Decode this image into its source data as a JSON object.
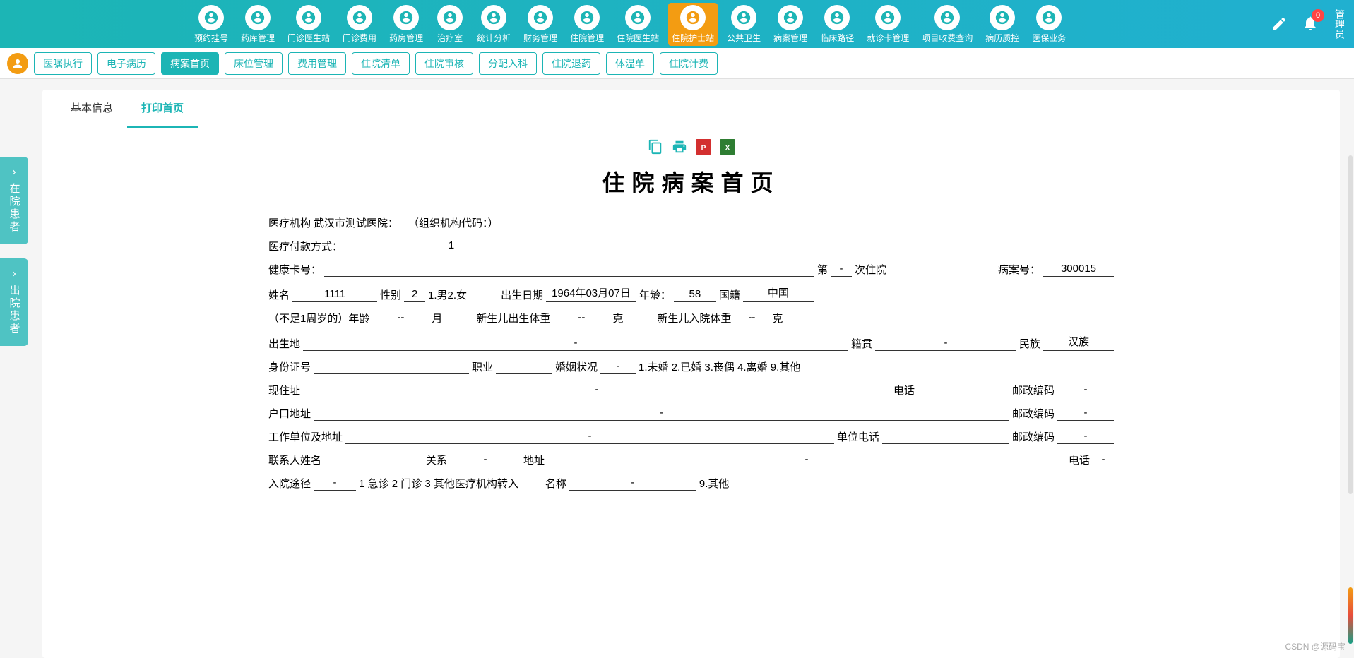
{
  "topNav": {
    "items": [
      {
        "label": "预约挂号",
        "icon": "calendar"
      },
      {
        "label": "药库管理",
        "icon": "home"
      },
      {
        "label": "门诊医生站",
        "icon": "doctor"
      },
      {
        "label": "门诊费用",
        "icon": "yen"
      },
      {
        "label": "药房管理",
        "icon": "pill"
      },
      {
        "label": "治疗室",
        "icon": "treat"
      },
      {
        "label": "统计分析",
        "icon": "chart"
      },
      {
        "label": "财务管理",
        "icon": "gear"
      },
      {
        "label": "住院管理",
        "icon": "bed"
      },
      {
        "label": "住院医生站",
        "icon": "docbed"
      },
      {
        "label": "住院护士站",
        "icon": "nurse",
        "active": true
      },
      {
        "label": "公共卫生",
        "icon": "target"
      },
      {
        "label": "病案管理",
        "icon": "file"
      },
      {
        "label": "临床路径",
        "icon": "path"
      },
      {
        "label": "就诊卡管理",
        "icon": "card"
      },
      {
        "label": "项目收费查询",
        "icon": "search"
      },
      {
        "label": "病历质控",
        "icon": "quality"
      },
      {
        "label": "医保业务",
        "icon": "insurance"
      }
    ],
    "badgeCount": "0",
    "adminLabel": "管理员"
  },
  "subNav": {
    "items": [
      {
        "label": "医嘱执行"
      },
      {
        "label": "电子病历"
      },
      {
        "label": "病案首页",
        "active": true
      },
      {
        "label": "床位管理"
      },
      {
        "label": "费用管理"
      },
      {
        "label": "住院清单"
      },
      {
        "label": "住院审核"
      },
      {
        "label": "分配入科"
      },
      {
        "label": "住院退药"
      },
      {
        "label": "体温单"
      },
      {
        "label": "住院计费"
      }
    ]
  },
  "sideTabs": [
    {
      "label": "在院患者"
    },
    {
      "label": "出院患者"
    }
  ],
  "contentTabs": [
    {
      "label": "基本信息"
    },
    {
      "label": "打印首页",
      "active": true
    }
  ],
  "doc": {
    "title": "住院病案首页",
    "orgLabel": "医疗机构",
    "orgName": "武汉市测试医院：",
    "orgCodeLabel": "（组织机构代码：）",
    "paymentLabel": "医疗付款方式：",
    "paymentValue": "1",
    "healthCardLabel": "健康卡号：",
    "admissionPrefix": "第",
    "admissionValue": "-",
    "admissionSuffix": "次住院",
    "caseNoLabel": "病案号：",
    "caseNoValue": "300015",
    "nameLabel": "姓名",
    "nameValue": "1111",
    "genderLabel": "性别",
    "genderValue": "2",
    "genderOptions": "1.男2.女",
    "birthLabel": "出生日期",
    "birthValue": "1964年03月07日",
    "ageLabel": "年龄：",
    "ageValue": "58",
    "nationalityLabel": "国籍",
    "nationalityValue": "中国",
    "infantAgeLabel": "（不足1周岁的）年龄",
    "infantAgeValue": "--",
    "monthUnit": "月",
    "birthWeightLabel": "新生儿出生体重",
    "birthWeightValue": "--",
    "weightUnit": "克",
    "admitWeightLabel": "新生儿入院体重",
    "admitWeightValue": "--",
    "birthPlaceLabel": "出生地",
    "birthPlaceValue": "-",
    "nativeLabel": "籍贯",
    "nativeValue": "-",
    "ethnicLabel": "民族",
    "ethnicValue": "汉族",
    "idLabel": "身份证号",
    "occupationLabel": "职业",
    "maritalLabel": "婚姻状况",
    "maritalValue": "-",
    "maritalOptions": "1.未婚 2.已婚 3.丧偶 4.离婚 9.其他",
    "addressLabel": "现住址",
    "addressValue": "-",
    "phoneLabel": "电话",
    "postalLabel": "邮政编码",
    "postalValue": "-",
    "hukouLabel": "户口地址",
    "hukouValue": "-",
    "workLabel": "工作单位及地址",
    "workValue": "-",
    "workPhoneLabel": "单位电话",
    "contactLabel": "联系人姓名",
    "relationLabel": "关系",
    "relationValue": "-",
    "contactAddrLabel": "地址",
    "contactAddrValue": "-",
    "contactPhoneLabel": "电话",
    "contactPhoneValue": "-",
    "admitRouteLabel": "入院途径",
    "admitRouteValue": "-",
    "admitRouteOptions": "1 急诊 2 门诊 3 其他医疗机构转入",
    "admitNameLabel": "名称",
    "admitNameValue": "-",
    "admitOther": "9.其他"
  },
  "watermark": "CSDN @源码宝"
}
